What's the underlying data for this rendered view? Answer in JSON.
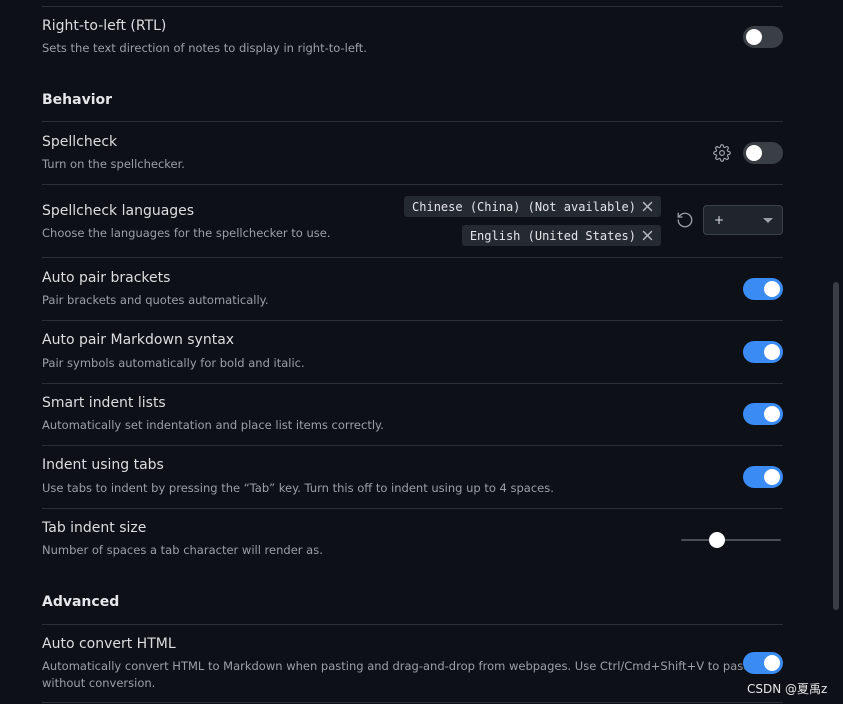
{
  "settings": {
    "rtl": {
      "name": "Right-to-left (RTL)",
      "desc": "Sets the text direction of notes to display in right-to-left.",
      "enabled": false
    },
    "behavior_heading": "Behavior",
    "spellcheck": {
      "name": "Spellcheck",
      "desc": "Turn on the spellchecker.",
      "enabled": false,
      "icon": "gear-icon"
    },
    "spellcheck_languages": {
      "name": "Spellcheck languages",
      "desc": "Choose the languages for the spellchecker to use.",
      "chips": [
        {
          "label": "Chinese (China) (Not available)"
        },
        {
          "label": "English (United States)"
        }
      ],
      "dropdown_value": "+"
    },
    "auto_pair_brackets": {
      "name": "Auto pair brackets",
      "desc": "Pair brackets and quotes automatically.",
      "enabled": true
    },
    "auto_pair_markdown": {
      "name": "Auto pair Markdown syntax",
      "desc": "Pair symbols automatically for bold and italic.",
      "enabled": true
    },
    "smart_indent": {
      "name": "Smart indent lists",
      "desc": "Automatically set indentation and place list items correctly.",
      "enabled": true
    },
    "indent_tabs": {
      "name": "Indent using tabs",
      "desc": "Use tabs to indent by pressing the “Tab” key. Turn this off to indent using up to 4 spaces.",
      "enabled": true
    },
    "tab_indent_size": {
      "name": "Tab indent size",
      "desc": "Number of spaces a tab character will render as.",
      "slider_fraction": 0.36
    },
    "advanced_heading": "Advanced",
    "auto_convert_html": {
      "name": "Auto convert HTML",
      "desc_line1": "Automatically convert HTML to Markdown when pasting and drag-and-drop from webpages. Use Ctrl/Cmd+Shift+V to paste",
      "desc_line2": "without conversion.",
      "enabled": true
    }
  },
  "colors": {
    "accent": "#3b8bf5",
    "background": "#0d1117",
    "toggle_off": "#3a3e45"
  },
  "watermark": "CSDN @夏禹z"
}
